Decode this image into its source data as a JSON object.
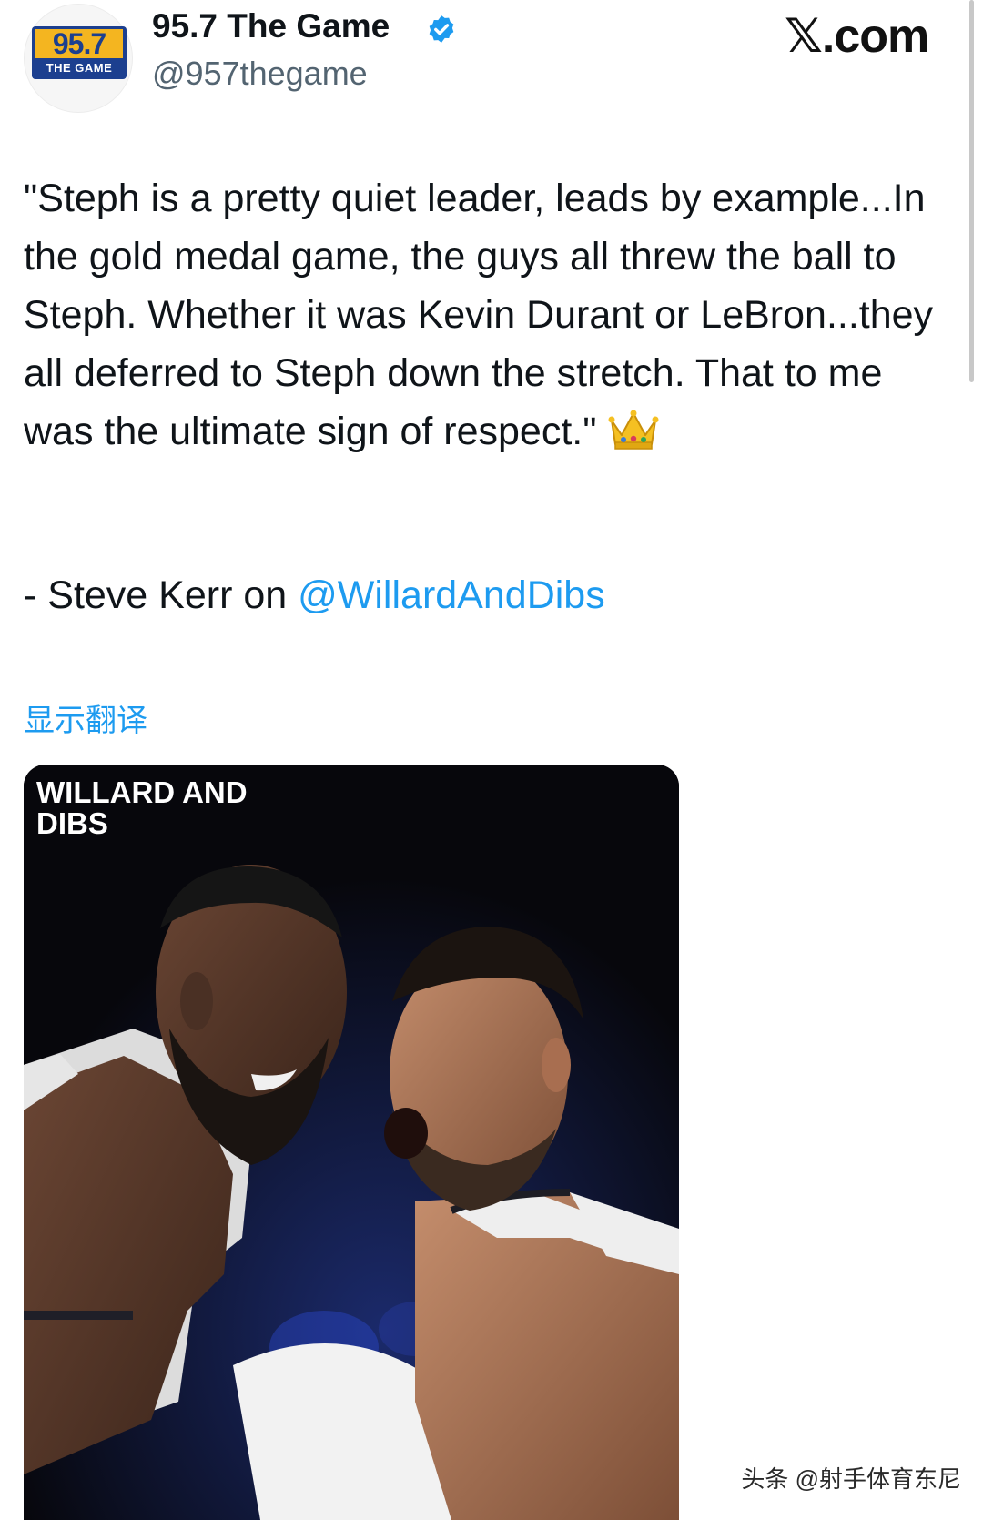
{
  "account": {
    "logo": {
      "number": "95.7",
      "subtitle": "THE GAME"
    },
    "display_name": "95.7 The Game",
    "handle": "@957thegame"
  },
  "brand": "𝕏.com",
  "tweet": {
    "text": "\"Steph is a pretty quiet leader, leads by example...In the gold medal game, the guys all threw the ball to Steph. Whether it was Kevin Durant or LeBron...they all deferred to Steph down the stretch. That to me was the ultimate sign of respect.\"",
    "attribution_prefix": "- Steve Kerr on ",
    "attribution_mention": "@WillardAndDibs",
    "translate_label": "显示翻译"
  },
  "media": {
    "overlay_title": "WILLARD AND DIBS",
    "description_icons": [
      "crown-icon"
    ]
  },
  "watermark": "头条 @射手体育东尼",
  "colors": {
    "link": "#1d9bf0",
    "secondary": "#536471",
    "logo_blue": "#1c3f8f",
    "logo_gold": "#f4b520"
  }
}
